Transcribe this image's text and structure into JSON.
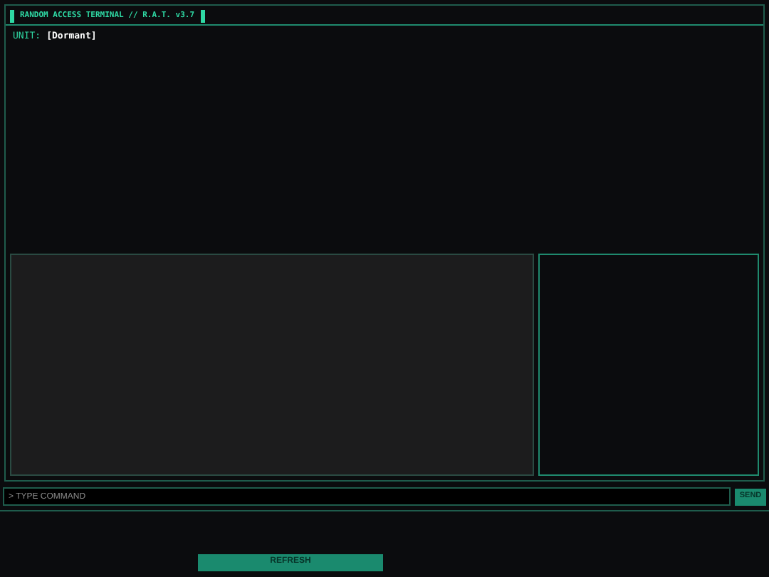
{
  "window": {
    "title": "RANDOM ACCESS TERMINAL // R.A.T. v3.7"
  },
  "unit": {
    "label": "UNIT:",
    "value": "[Dormant]"
  },
  "command": {
    "placeholder": "> TYPE COMMAND",
    "button": "SEND"
  },
  "refresh_button": "REFRESH"
}
